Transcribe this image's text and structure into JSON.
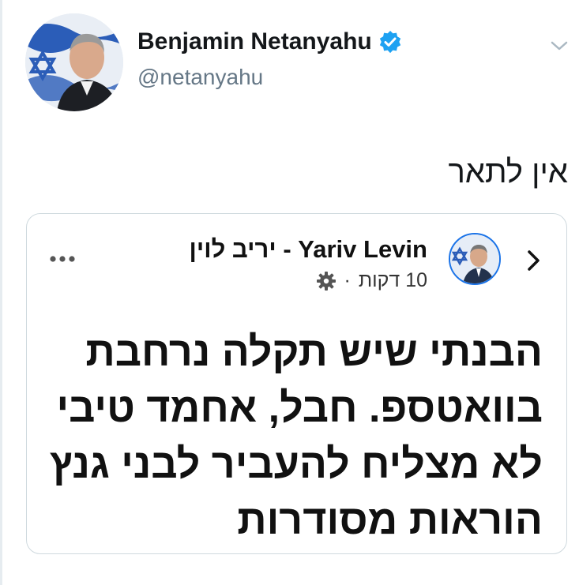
{
  "tweet": {
    "author_name": "Benjamin Netanyahu",
    "author_handle": "@netanyahu",
    "text": "אין לתאר"
  },
  "quoted_post": {
    "author": "Yariv Levin - יריב לוין",
    "time": "10 דקות",
    "separator": "·",
    "body_lines": [
      "הבנתי שיש תקלה נרחבת",
      "בוואטספ. חבל, אחמד טיבי",
      "לא מצליח להעביר לבני גנץ",
      "הוראות מסודרות"
    ]
  },
  "colors": {
    "verified_badge": "#1da1f2",
    "name_text": "#14171a",
    "handle_text": "#657786",
    "card_border": "#cfd9de"
  },
  "icons": {
    "verified": "verified-badge-icon",
    "caret": "chevron-down-icon",
    "more": "more-dots-icon",
    "privacy": "gear-icon",
    "back": "chevron-right-icon"
  }
}
